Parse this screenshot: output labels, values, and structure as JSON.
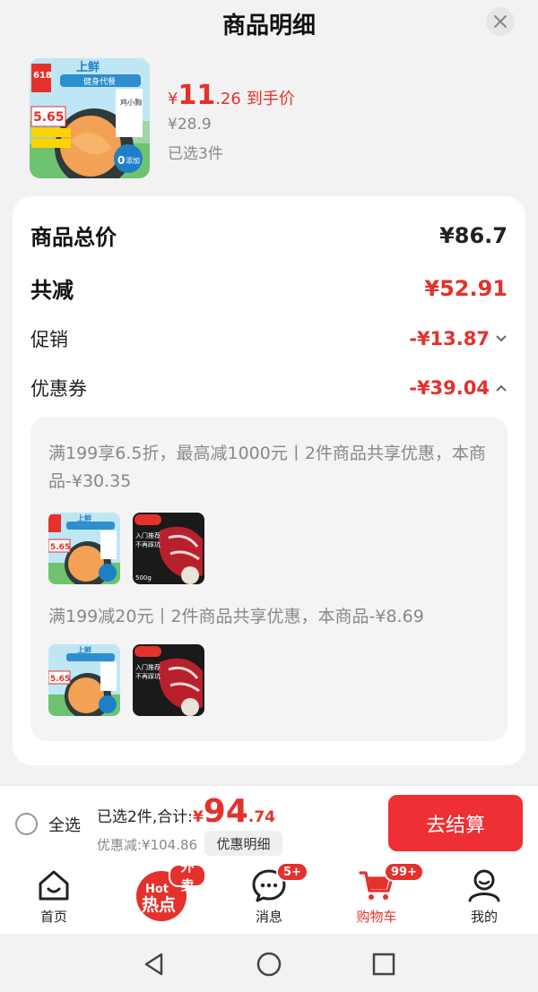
{
  "sheet": {
    "title": "商品明细"
  },
  "product": {
    "price_symbol": "¥",
    "price_int": "11",
    "price_dec": ".26",
    "price_tag": "到手价",
    "original_price": "¥28.9",
    "selected_count": "已选3件"
  },
  "summary": {
    "total_label": "商品总价",
    "total_value": "¥86.7",
    "reduce_label": "共减",
    "reduce_value": "¥52.91",
    "promo_label": "促销",
    "promo_value": "-¥13.87",
    "coupon_label": "优惠券",
    "coupon_value": "-¥39.04"
  },
  "coupons": [
    {
      "text": "满199享6.5折，最高减1000元丨2件商品共享优惠，本商品-¥30.35"
    },
    {
      "text": "满199减20元丨2件商品共享优惠，本商品-¥8.69"
    }
  ],
  "bottom": {
    "select_all": "全选",
    "total_prefix": "已选2件,合计:",
    "total_symbol": "¥",
    "total_int": "94",
    "total_dec": ".74",
    "discount": "优惠减:¥104.86",
    "detail_button": "优惠明细",
    "checkout": "去结算"
  },
  "tabs": [
    {
      "label": "首页",
      "icon": "home-icon"
    },
    {
      "label": "",
      "icon": "hot-icon",
      "badge": "外卖",
      "text1": "Hot",
      "text2": "热点"
    },
    {
      "label": "消息",
      "icon": "message-icon",
      "badge": "5+"
    },
    {
      "label": "购物车",
      "icon": "cart-icon",
      "badge": "99+"
    },
    {
      "label": "我的",
      "icon": "profile-icon"
    }
  ],
  "thumb_text": {
    "brand": "上鲜",
    "event": "618",
    "price": "5.65",
    "slogan": "健身代餐",
    "zero": "0",
    "zero_label": "添加",
    "product_name": "鸡小胸",
    "beef_label1": "入门推荐",
    "beef_label2": "不再踩坑",
    "beef_weight": "500g"
  },
  "colors": {
    "accent": "#e4312c",
    "checkout": "#ef2f36"
  }
}
